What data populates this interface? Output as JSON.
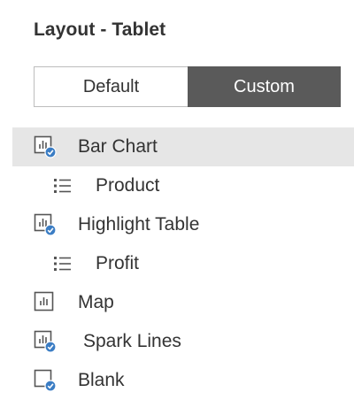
{
  "panel": {
    "title": "Layout - Tablet"
  },
  "segmented": {
    "options": [
      {
        "label": "Default",
        "selected": false
      },
      {
        "label": "Custom",
        "selected": true
      }
    ]
  },
  "items": [
    {
      "label": "Bar Chart",
      "icon": "sheet-checked-icon",
      "selected": true
    },
    {
      "label": "Product",
      "icon": "legend-list-icon",
      "selected": false
    },
    {
      "label": "Highlight Table",
      "icon": "sheet-checked-icon",
      "selected": false
    },
    {
      "label": "Profit",
      "icon": "legend-list-icon",
      "selected": false
    },
    {
      "label": "Map",
      "icon": "sheet-icon",
      "selected": false
    },
    {
      "label": "Spark Lines",
      "icon": "sheet-checked-icon",
      "selected": false
    },
    {
      "label": "Blank",
      "icon": "blank-checked-icon",
      "selected": false
    }
  ],
  "colors": {
    "accent": "#3b7dc4",
    "selected_row": "#e6e6e6",
    "custom_button": "#5a5a5a"
  }
}
